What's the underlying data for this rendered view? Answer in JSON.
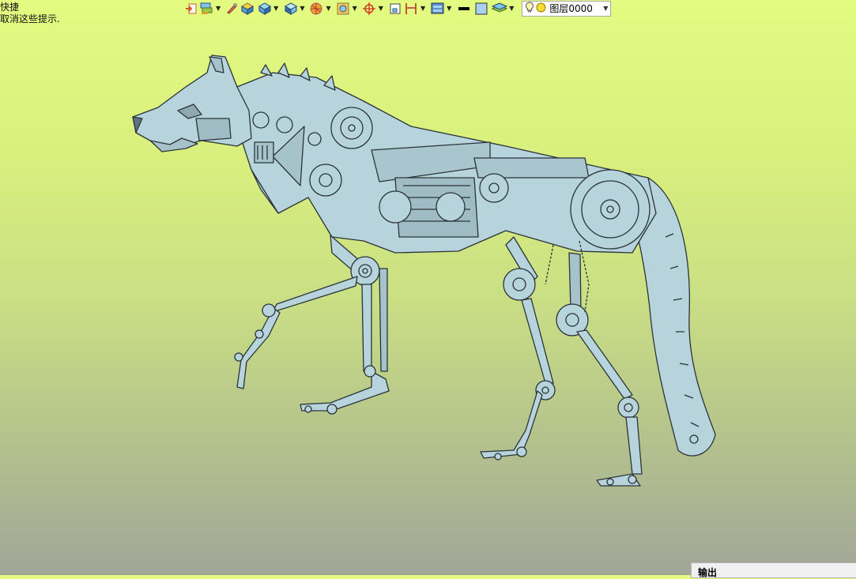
{
  "hint": {
    "line1": "快捷",
    "line2": "取消这些提示."
  },
  "toolbar": {
    "icons": [
      "import-icon",
      "material-icon",
      "brush-icon",
      "solid-box-icon",
      "view-cube-icon",
      "view-orient-icon",
      "render-sphere-icon",
      "display-mode-icon",
      "snap-target-icon",
      "select-box-icon",
      "dimension-icon",
      "layer-manager-icon",
      "line-color-swatch",
      "fill-color-swatch",
      "layers-icon"
    ],
    "layer": {
      "name": "图层0000",
      "icons": [
        "bulb-icon",
        "freeze-icon"
      ]
    }
  },
  "output_panel": {
    "title": "输出"
  },
  "model": {
    "fill": "#b7d3dc",
    "stroke": "#2a3438"
  },
  "colors": {
    "bg_top": "#e3fb80",
    "bg_bottom": "#a2a698"
  }
}
